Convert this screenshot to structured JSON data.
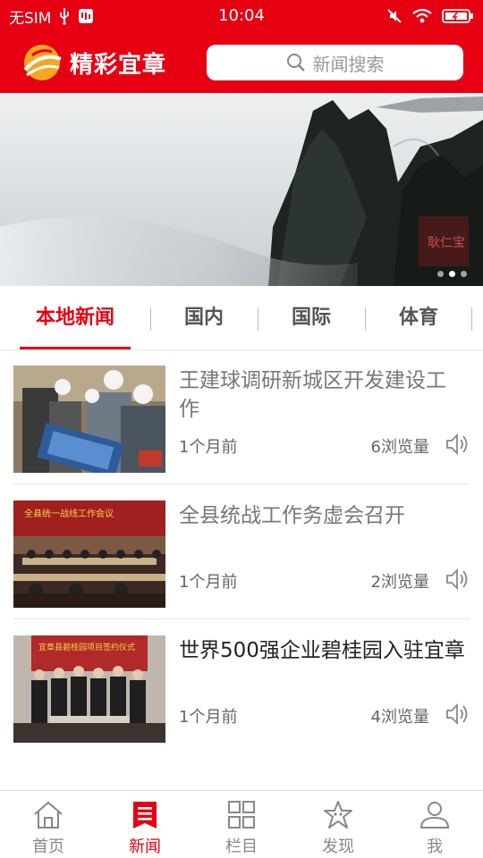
{
  "status_bar": {
    "carrier": "无SIM",
    "time": "10:04"
  },
  "header": {
    "app_title": "精彩宜章",
    "search_placeholder": "新闻搜索"
  },
  "banner": {
    "stamp_text": "耿仁宝",
    "dots": 3,
    "active_dot": 2
  },
  "tabs": [
    {
      "label": "本地新闻",
      "active": true
    },
    {
      "label": "国内",
      "active": false
    },
    {
      "label": "国际",
      "active": false
    },
    {
      "label": "体育",
      "active": false
    }
  ],
  "news": [
    {
      "title": "王建球调研新城区开发建设工作",
      "time": "1个月前",
      "views": "6浏览量",
      "thumb_caption": "",
      "dark": false
    },
    {
      "title": "全县统战工作务虚会召开",
      "time": "1个月前",
      "views": "2浏览量",
      "thumb_caption": "全县统一战线工作会议",
      "dark": false
    },
    {
      "title": "世界500强企业碧桂园入驻宜章",
      "time": "1个月前",
      "views": "4浏览量",
      "thumb_caption": "宜章县碧桂园项目签约仪式",
      "dark": true
    }
  ],
  "bottom_nav": [
    {
      "label": "首页",
      "icon": "home-icon",
      "active": false
    },
    {
      "label": "新闻",
      "icon": "news-icon",
      "active": true
    },
    {
      "label": "栏目",
      "icon": "grid-icon",
      "active": false
    },
    {
      "label": "发现",
      "icon": "star-icon",
      "active": false
    },
    {
      "label": "我",
      "icon": "user-icon",
      "active": false
    }
  ],
  "colors": {
    "brand": "#e60012",
    "muted_text": "#777777",
    "nav_inactive": "#888888"
  }
}
